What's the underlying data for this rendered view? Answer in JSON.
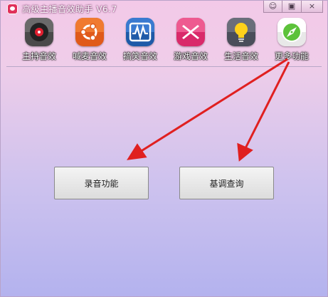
{
  "window": {
    "title": "高级主播音效助手 V6.7",
    "controls": {
      "feedback": "☺",
      "restore": "▣",
      "close": "×"
    }
  },
  "toolbar": {
    "items": [
      {
        "label": "主持音效",
        "icon": "disc-icon"
      },
      {
        "label": "喊麦音效",
        "icon": "ubuntu-icon"
      },
      {
        "label": "搞笑音效",
        "icon": "waveform-icon"
      },
      {
        "label": "游戏音效",
        "icon": "cross-icon"
      },
      {
        "label": "生活音效",
        "icon": "lightbulb-icon"
      },
      {
        "label": "更多功能",
        "icon": "compass-icon"
      }
    ]
  },
  "buttons": {
    "record": "录音功能",
    "key_query": "基调查询"
  },
  "colors": {
    "arrow": "#e02020",
    "title_accent": "#e0305a"
  }
}
